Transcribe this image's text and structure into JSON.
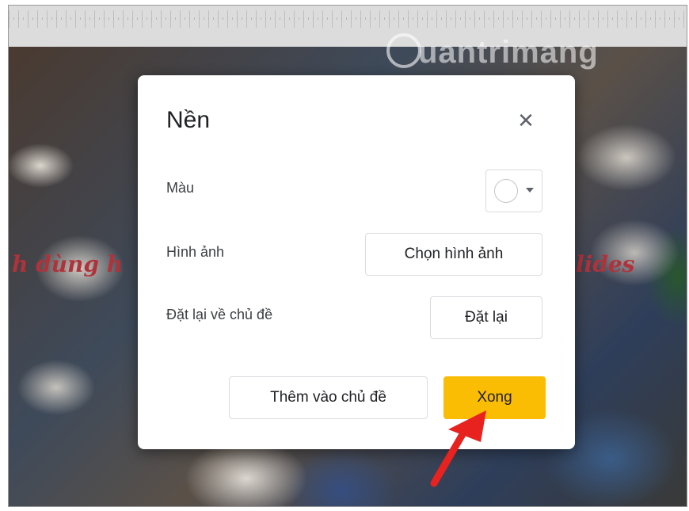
{
  "watermark": {
    "text": "uantrimang"
  },
  "slide": {
    "left_text": "h dùng h",
    "right_text": "lides"
  },
  "dialog": {
    "title": "Nền",
    "close_icon": "close-icon",
    "rows": {
      "color_label": "Màu",
      "image_label": "Hình ảnh",
      "reset_label": "Đặt lại về chủ đề"
    },
    "buttons": {
      "choose_image": "Chọn hình ảnh",
      "reset": "Đặt lại",
      "add_to_theme": "Thêm vào chủ đề",
      "done": "Xong"
    },
    "color_picker": {
      "selected_color": "#ffffff"
    },
    "accent_color": "#fbbc04"
  },
  "annotation": {
    "arrow_color": "#e8231f"
  }
}
